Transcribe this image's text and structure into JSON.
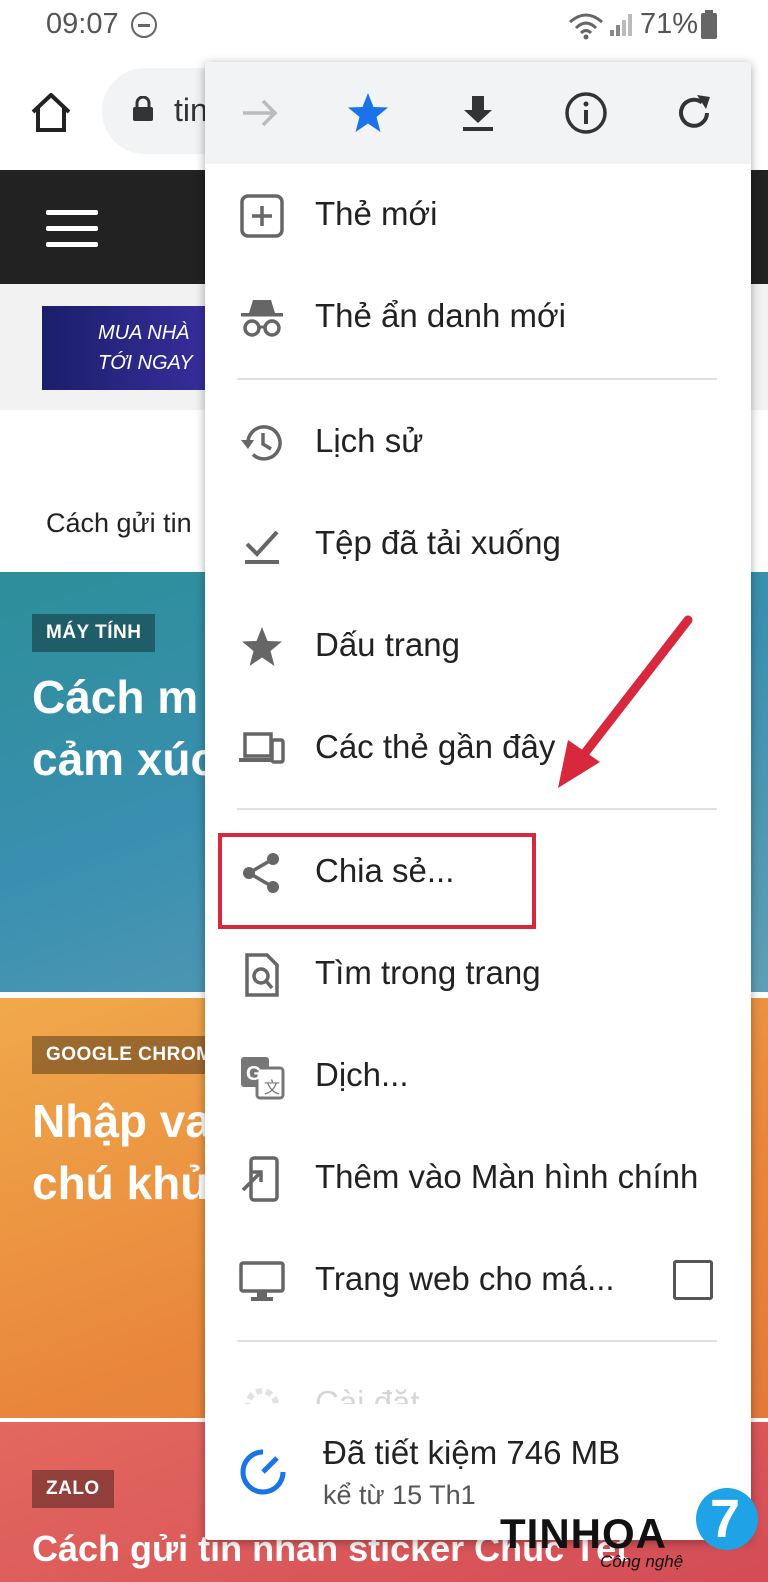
{
  "status_bar": {
    "time": "09:07",
    "battery": "71%"
  },
  "browser": {
    "url_fragment": "tin"
  },
  "site": {
    "ad_line1": "MUA NHÀ",
    "ad_line2": "TỚI NGAY",
    "breadcrumb": "Cách gửi tin",
    "cards": [
      {
        "tag": "MÁY TÍNH",
        "headline_line1": "Cách m",
        "headline_line2": "cảm xúc"
      },
      {
        "tag": "GOOGLE CHROM",
        "headline_line1": "Nhập va",
        "headline_line2": "chú khủ"
      },
      {
        "tag": "ZALO",
        "headline_line1": "Cách gửi tin nhắn sticker Chúc Tết"
      }
    ]
  },
  "menu": {
    "items": [
      {
        "label": "Thẻ mới",
        "icon": "new-tab-icon"
      },
      {
        "label": "Thẻ ẩn danh mới",
        "icon": "incognito-icon"
      },
      {
        "label": "Lịch sử",
        "icon": "history-icon"
      },
      {
        "label": "Tệp đã tải xuống",
        "icon": "downloads-icon"
      },
      {
        "label": "Dấu trang",
        "icon": "bookmarks-icon"
      },
      {
        "label": "Các thẻ gần đây",
        "icon": "recent-tabs-icon"
      },
      {
        "label": "Chia sẻ...",
        "icon": "share-icon"
      },
      {
        "label": "Tìm trong trang",
        "icon": "find-in-page-icon"
      },
      {
        "label": "Dịch...",
        "icon": "translate-icon"
      },
      {
        "label": "Thêm vào Màn hình chính",
        "icon": "add-to-home-icon"
      },
      {
        "label": "Trang web cho má...",
        "icon": "desktop-icon"
      },
      {
        "label": "Cài đặt",
        "icon": "settings-icon"
      }
    ],
    "savings_title": "Đã tiết kiệm 746 MB",
    "savings_sub": "kể từ 15 Th1",
    "desktop_site_checked": false
  },
  "logo": {
    "word": "TINHOA",
    "sub": "Công nghệ",
    "digit": "7"
  },
  "colors": {
    "accent_blue": "#1a73e8",
    "highlight_red": "#d8283e",
    "header_dark": "#222222"
  }
}
